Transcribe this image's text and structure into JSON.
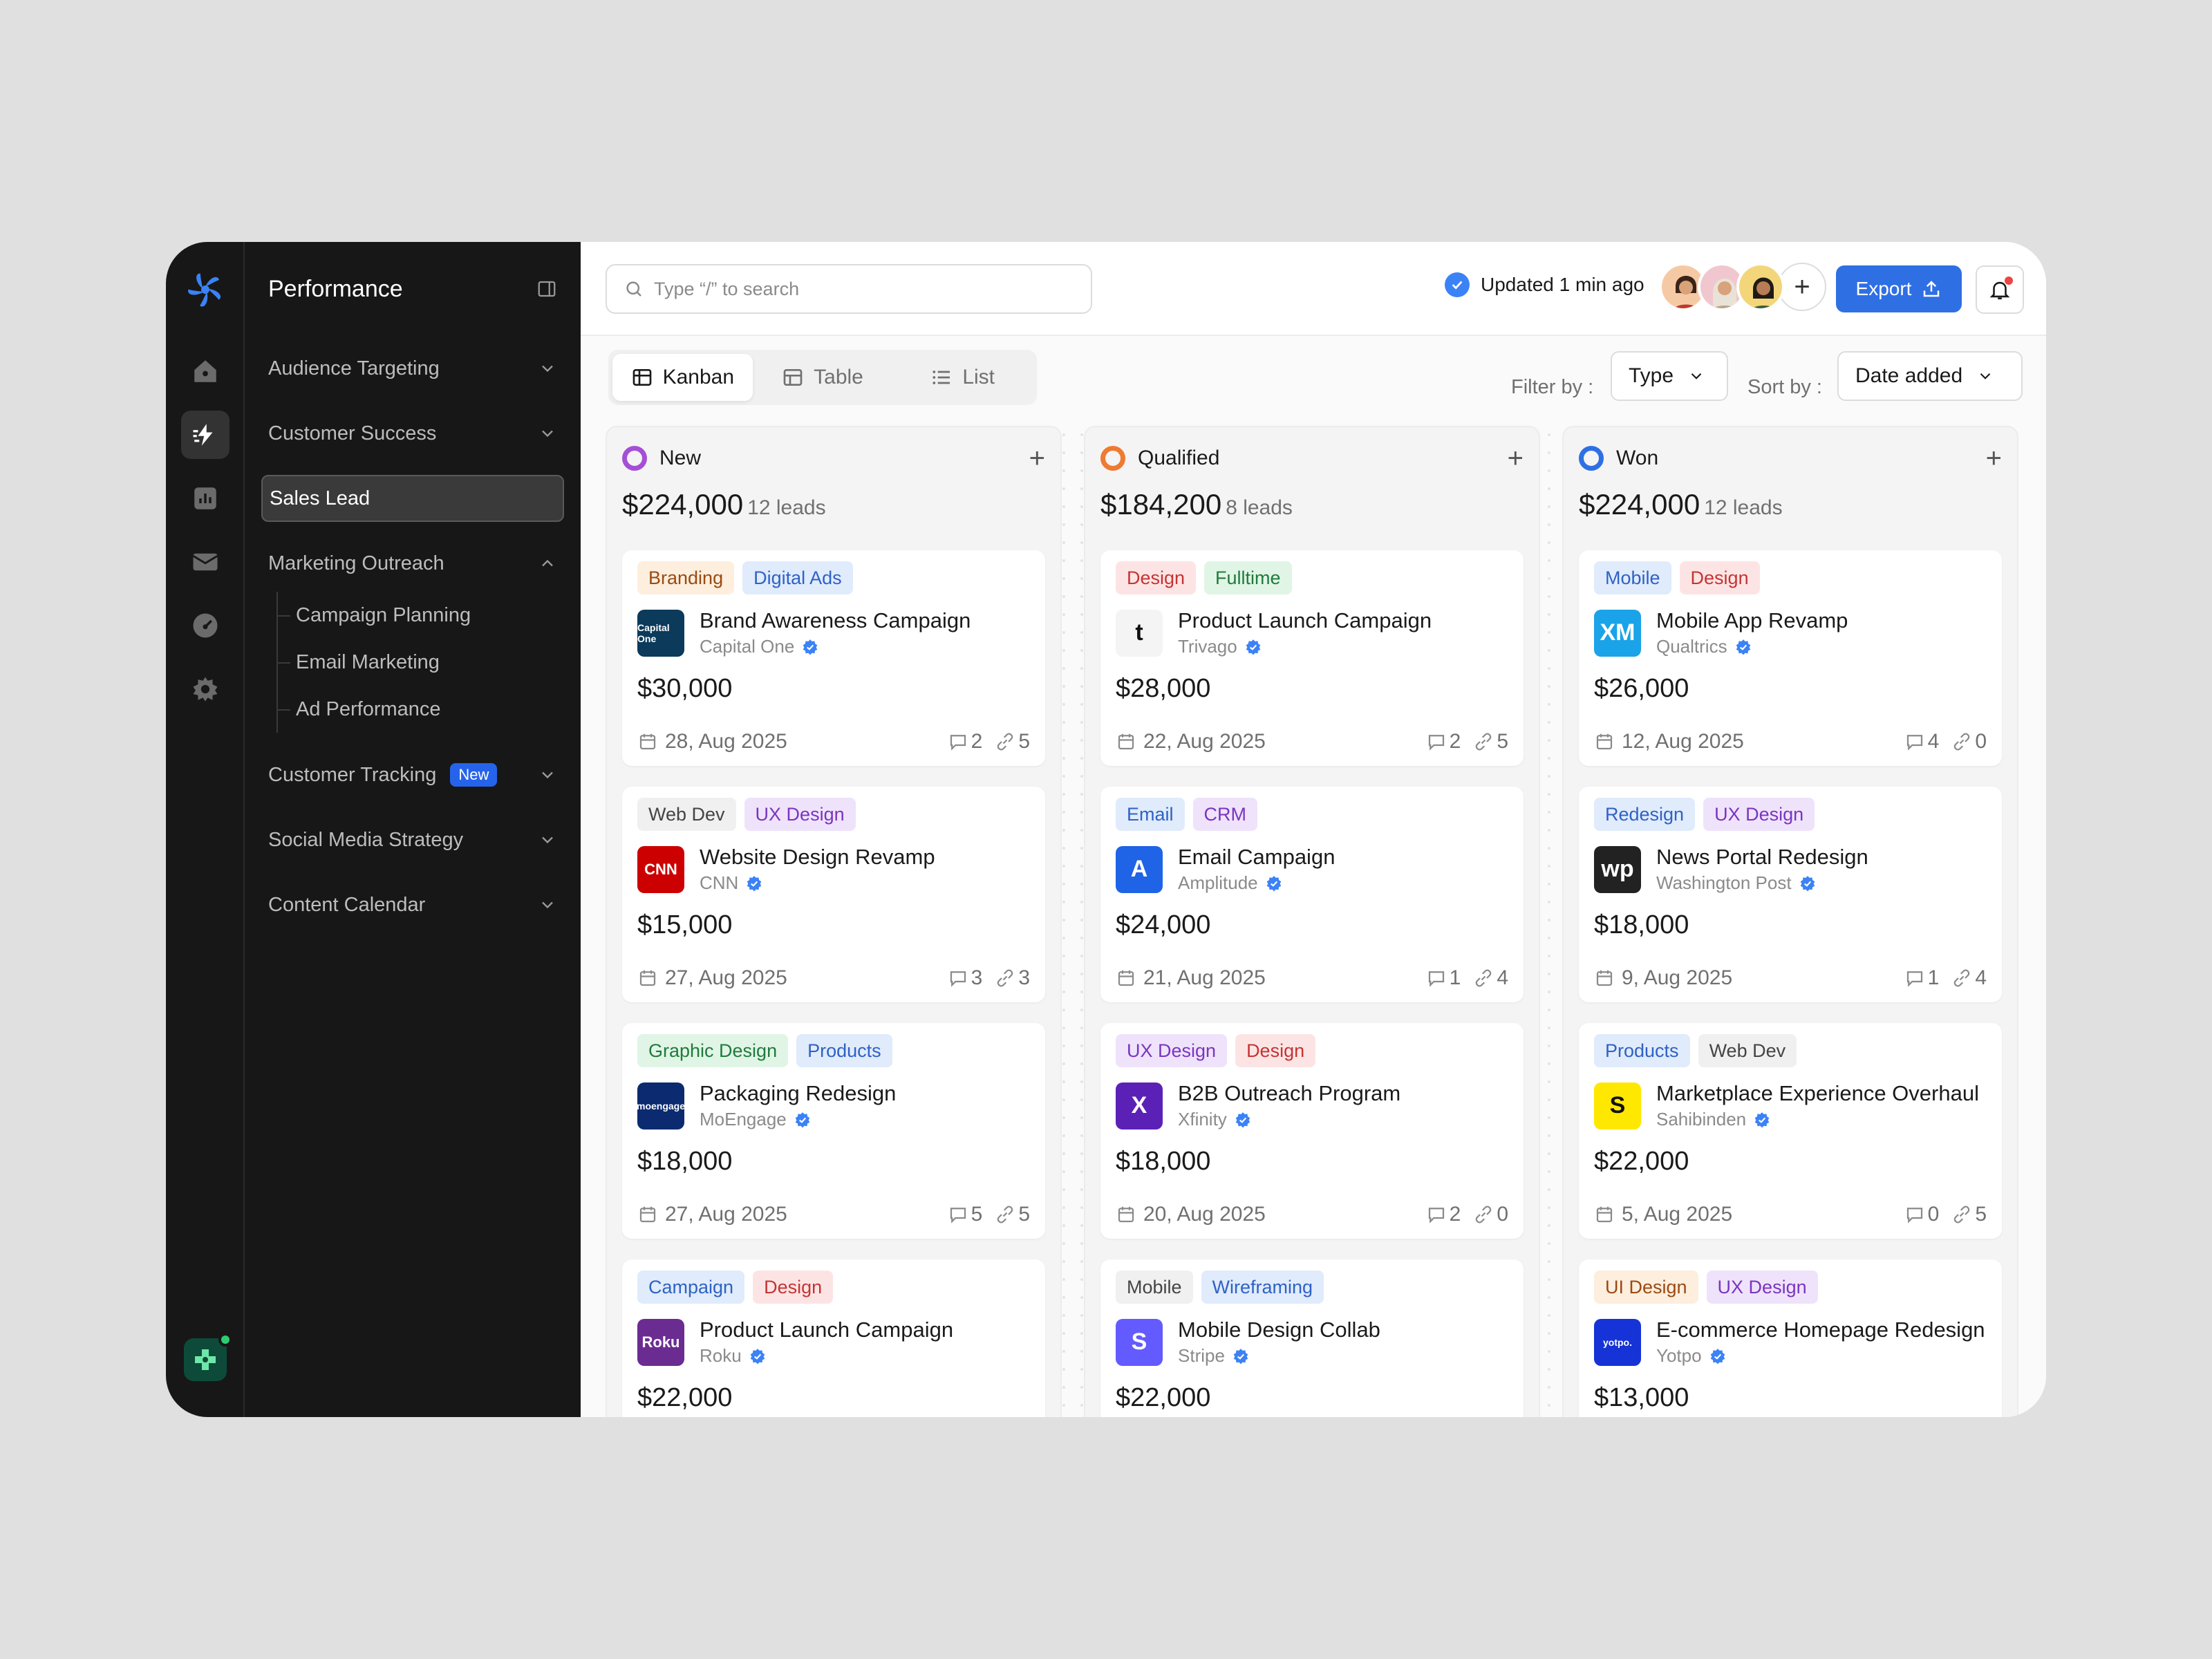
{
  "sidebar": {
    "title": "Performance",
    "items": [
      {
        "label": "Audience Targeting"
      },
      {
        "label": "Customer Success"
      },
      {
        "label": "Sales Lead"
      },
      {
        "label": "Marketing Outreach",
        "children": [
          "Campaign Planning",
          "Email Marketing",
          "Ad Performance"
        ]
      },
      {
        "label": "Customer Tracking",
        "badge": "New"
      },
      {
        "label": "Social Media Strategy"
      },
      {
        "label": "Content Calendar"
      }
    ]
  },
  "topbar": {
    "search_placeholder": "Type “/” to search",
    "updated": "Updated 1 min ago",
    "export_label": "Export"
  },
  "views": {
    "tabs": [
      "Kanban",
      "Table",
      "List"
    ],
    "active": "Kanban",
    "filter_label": "Filter by :",
    "filter_value": "Type",
    "sort_label": "Sort by :",
    "sort_value": "Date added"
  },
  "columns": [
    {
      "name": "New",
      "color": "#a54fd6",
      "total": "$224,000",
      "leads": "12 leads",
      "cards": [
        {
          "tags": [
            {
              "t": "Branding",
              "bg": "#fdeede",
              "fg": "#9a4a12"
            },
            {
              "t": "Digital Ads",
              "bg": "#e0ebfc",
              "fg": "#2f62c4"
            }
          ],
          "title": "Brand Awareness Campaign",
          "company": "Capital One",
          "logo": "Capital One",
          "logo_bg": "#0b3a5a",
          "amount": "$30,000",
          "date": "28, Aug 2025",
          "comments": "2",
          "links": "5"
        },
        {
          "tags": [
            {
              "t": "Web Dev",
              "bg": "#f0f0f0",
              "fg": "#444444"
            },
            {
              "t": "UX Design",
              "bg": "#efe3fb",
              "fg": "#7a35c0"
            }
          ],
          "title": "Website Design Revamp",
          "company": "CNN",
          "logo": "CNN",
          "logo_bg": "#cc0000",
          "amount": "$15,000",
          "date": "27, Aug 2025",
          "comments": "3",
          "links": "3"
        },
        {
          "tags": [
            {
              "t": "Graphic Design",
              "bg": "#e0f5e6",
              "fg": "#217a3c"
            },
            {
              "t": "Products",
              "bg": "#e0ebfc",
              "fg": "#2f62c4"
            }
          ],
          "title": "Packaging Redesign",
          "company": "MoEngage",
          "logo": "moengage",
          "logo_bg": "#0b2a6f",
          "amount": "$18,000",
          "date": "27, Aug 2025",
          "comments": "5",
          "links": "5"
        },
        {
          "tags": [
            {
              "t": "Campaign",
              "bg": "#e0ebfc",
              "fg": "#2f62c4"
            },
            {
              "t": "Design",
              "bg": "#fde4e4",
              "fg": "#c43434"
            }
          ],
          "title": "Product Launch Campaign",
          "company": "Roku",
          "logo": "Roku",
          "logo_bg": "#6a2c91",
          "amount": "$22,000",
          "date": "",
          "comments": "",
          "links": ""
        }
      ]
    },
    {
      "name": "Qualified",
      "color": "#ef7a33",
      "total": "$184,200",
      "leads": "8 leads",
      "cards": [
        {
          "tags": [
            {
              "t": "Design",
              "bg": "#fde4e4",
              "fg": "#c43434"
            },
            {
              "t": "Fulltime",
              "bg": "#e0f5e6",
              "fg": "#217a3c"
            }
          ],
          "title": "Product Launch Campaign",
          "company": "Trivago",
          "logo": "t",
          "logo_bg": "#f4f4f4",
          "amount": "$28,000",
          "date": "22, Aug 2025",
          "comments": "2",
          "links": "5"
        },
        {
          "tags": [
            {
              "t": "Email",
              "bg": "#e0ebfc",
              "fg": "#2f62c4"
            },
            {
              "t": "CRM",
              "bg": "#efe3fb",
              "fg": "#7a35c0"
            }
          ],
          "title": "Email Campaign",
          "company": "Amplitude",
          "logo": "A",
          "logo_bg": "#1f63e6",
          "amount": "$24,000",
          "date": "21, Aug 2025",
          "comments": "1",
          "links": "4"
        },
        {
          "tags": [
            {
              "t": "UX Design",
              "bg": "#efe3fb",
              "fg": "#7a35c0"
            },
            {
              "t": "Design",
              "bg": "#fde4e4",
              "fg": "#c43434"
            }
          ],
          "title": "B2B Outreach Program",
          "company": "Xfinity",
          "logo": "X",
          "logo_bg": "#5b21b6",
          "amount": "$18,000",
          "date": "20, Aug 2025",
          "comments": "2",
          "links": "0"
        },
        {
          "tags": [
            {
              "t": "Mobile",
              "bg": "#f0f0f0",
              "fg": "#444444"
            },
            {
              "t": "Wireframing",
              "bg": "#e0ebfc",
              "fg": "#2f62c4"
            }
          ],
          "title": "Mobile Design Collab",
          "company": "Stripe",
          "logo": "S",
          "logo_bg": "#635bff",
          "amount": "$22,000",
          "date": "",
          "comments": "",
          "links": ""
        }
      ]
    },
    {
      "name": "Won",
      "color": "#2f6fe4",
      "total": "$224,000",
      "leads": "12 leads",
      "cards": [
        {
          "tags": [
            {
              "t": "Mobile",
              "bg": "#e0ebfc",
              "fg": "#2f62c4"
            },
            {
              "t": "Design",
              "bg": "#fde4e4",
              "fg": "#c43434"
            }
          ],
          "title": "Mobile App Revamp",
          "company": "Qualtrics",
          "logo": "XM",
          "logo_bg": "#1aa3e8",
          "amount": "$26,000",
          "date": "12, Aug 2025",
          "comments": "4",
          "links": "0"
        },
        {
          "tags": [
            {
              "t": "Redesign",
              "bg": "#e0ebfc",
              "fg": "#2f62c4"
            },
            {
              "t": "UX Design",
              "bg": "#efe3fb",
              "fg": "#7a35c0"
            }
          ],
          "title": "News Portal Redesign",
          "company": "Washington Post",
          "logo": "wp",
          "logo_bg": "#222222",
          "amount": "$18,000",
          "date": "9, Aug 2025",
          "comments": "1",
          "links": "4"
        },
        {
          "tags": [
            {
              "t": "Products",
              "bg": "#e0ebfc",
              "fg": "#2f62c4"
            },
            {
              "t": "Web Dev",
              "bg": "#f0f0f0",
              "fg": "#444444"
            }
          ],
          "title": "Marketplace Experience Overhaul",
          "company": "Sahibinden",
          "logo": "S",
          "logo_bg": "#ffe800",
          "amount": "$22,000",
          "date": "5, Aug 2025",
          "comments": "0",
          "links": "5"
        },
        {
          "tags": [
            {
              "t": "UI Design",
              "bg": "#fdeede",
              "fg": "#9a4a12"
            },
            {
              "t": "UX Design",
              "bg": "#efe3fb",
              "fg": "#7a35c0"
            }
          ],
          "title": "E-commerce Homepage Redesign",
          "company": "Yotpo",
          "logo": "yotpo.",
          "logo_bg": "#1533d6",
          "amount": "$13,000",
          "date": "",
          "comments": "",
          "links": ""
        }
      ]
    }
  ]
}
